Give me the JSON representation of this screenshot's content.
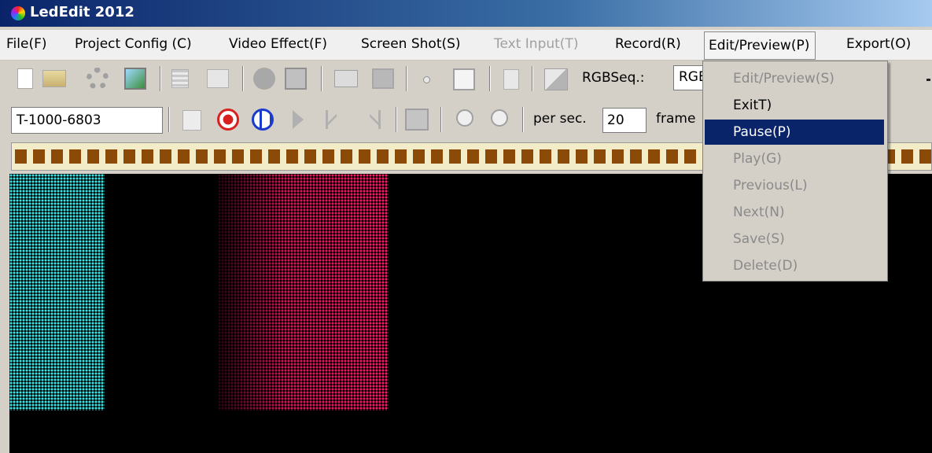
{
  "window": {
    "title": "LedEdit 2012"
  },
  "menubar": {
    "items": [
      {
        "label": "File(F)",
        "enabled": true
      },
      {
        "label": "Project Config (C)",
        "enabled": true
      },
      {
        "label": "Video Effect(F)",
        "enabled": true
      },
      {
        "label": "Screen Shot(S)",
        "enabled": true
      },
      {
        "label": "Text Input(T)",
        "enabled": false
      },
      {
        "label": "Record(R)",
        "enabled": true
      },
      {
        "label": "Edit/Preview(P)",
        "enabled": true,
        "open": true
      },
      {
        "label": "Export(O)",
        "enabled": true
      }
    ]
  },
  "toolbar1": {
    "rgb_label": "RGBSeq.:",
    "rgb_value": "RGB",
    "icons": [
      "new-file-icon",
      "open-folder-icon",
      "gear-icon",
      "image-icon",
      "grid-icon",
      "copy-icon",
      "flash-icon",
      "frame-icon",
      "screenshot-icon",
      "capture-icon",
      "dot-icon",
      "square-icon",
      "text-icon",
      "arrow-icon"
    ]
  },
  "toolbar2": {
    "project_name": "T-1000-6803",
    "per_sec_label": "per sec.",
    "fps_value": "20",
    "frame_label": "frame",
    "icons": [
      "preview-icon",
      "stop-icon",
      "pause-icon",
      "play-icon",
      "previous-icon",
      "next-icon",
      "save-frame-icon",
      "zoom-in-icon",
      "zoom-out-icon"
    ]
  },
  "edit_preview_menu": {
    "items": [
      {
        "label": "Edit/Preview(S)",
        "enabled": false,
        "selected": false
      },
      {
        "label": "ExitT)",
        "enabled": true,
        "selected": false
      },
      {
        "label": "Pause(P)",
        "enabled": true,
        "selected": true
      },
      {
        "label": "Play(G)",
        "enabled": false,
        "selected": false
      },
      {
        "label": "Previous(L)",
        "enabled": false,
        "selected": false
      },
      {
        "label": "Next(N)",
        "enabled": false,
        "selected": false
      },
      {
        "label": "Save(S)",
        "enabled": false,
        "selected": false
      },
      {
        "label": "Delete(D)",
        "enabled": false,
        "selected": false
      }
    ]
  },
  "colors": {
    "led_cyan": "#2ee6e6",
    "led_pink": "#ff1a66",
    "selection": "#0a246a",
    "frame_strip": "#8b4a08"
  }
}
